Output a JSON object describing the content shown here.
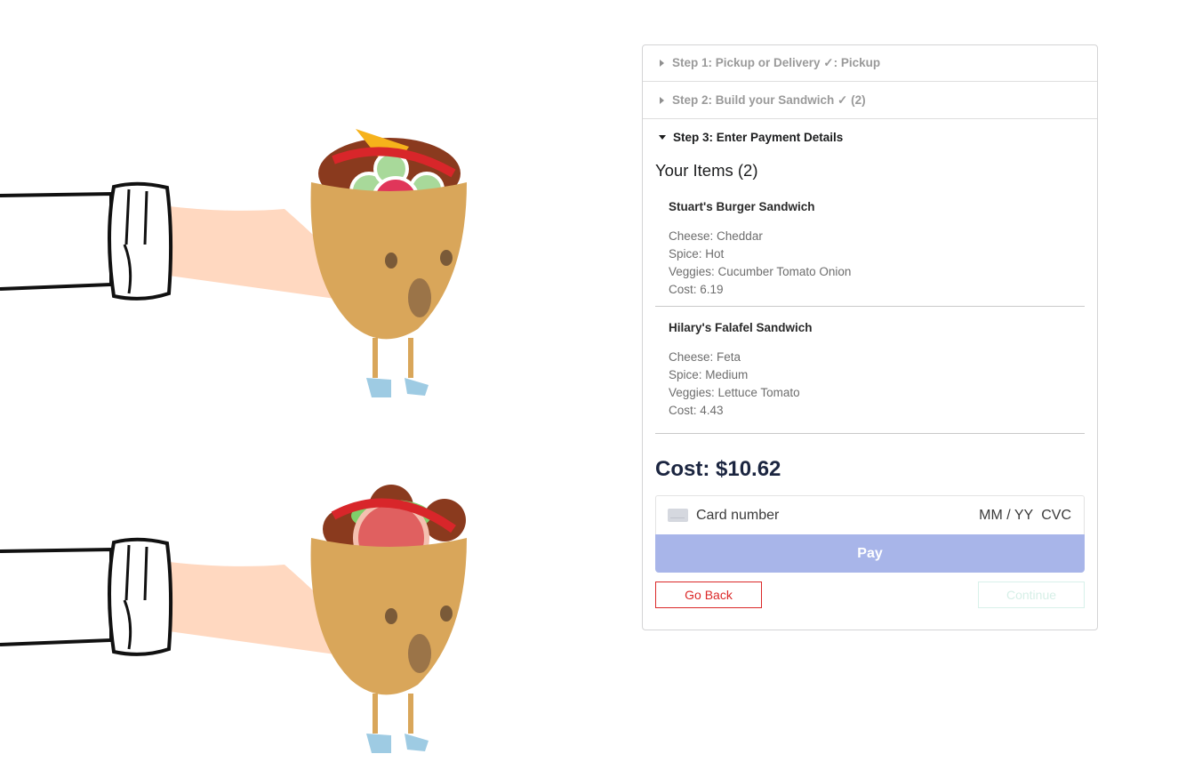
{
  "steps": [
    {
      "label": "Step 1: Pickup or Delivery ✓: Pickup"
    },
    {
      "label": "Step 2: Build your Sandwich ✓ (2)"
    },
    {
      "label": "Step 3: Enter Payment Details"
    }
  ],
  "items_heading": "Your Items (2)",
  "items": [
    {
      "name": "Stuart's Burger Sandwich",
      "cheese": "Cheese: Cheddar",
      "spice": "Spice: Hot",
      "veggies": "Veggies: Cucumber Tomato Onion",
      "cost": "Cost: 6.19"
    },
    {
      "name": "Hilary's Falafel Sandwich",
      "cheese": "Cheese: Feta",
      "spice": "Spice: Medium",
      "veggies": "Veggies: Lettuce Tomato",
      "cost": "Cost: 4.43"
    }
  ],
  "total": "Cost: $10.62",
  "payment": {
    "card_placeholder": "Card number",
    "expiry_placeholder": "MM / YY",
    "cvc_placeholder": "CVC",
    "pay_label": "Pay"
  },
  "nav": {
    "back_label": "Go Back",
    "continue_label": "Continue"
  },
  "colors": {
    "pay_button": "#a8b5e9",
    "back_button": "#db2828",
    "title": "#1b2540"
  }
}
